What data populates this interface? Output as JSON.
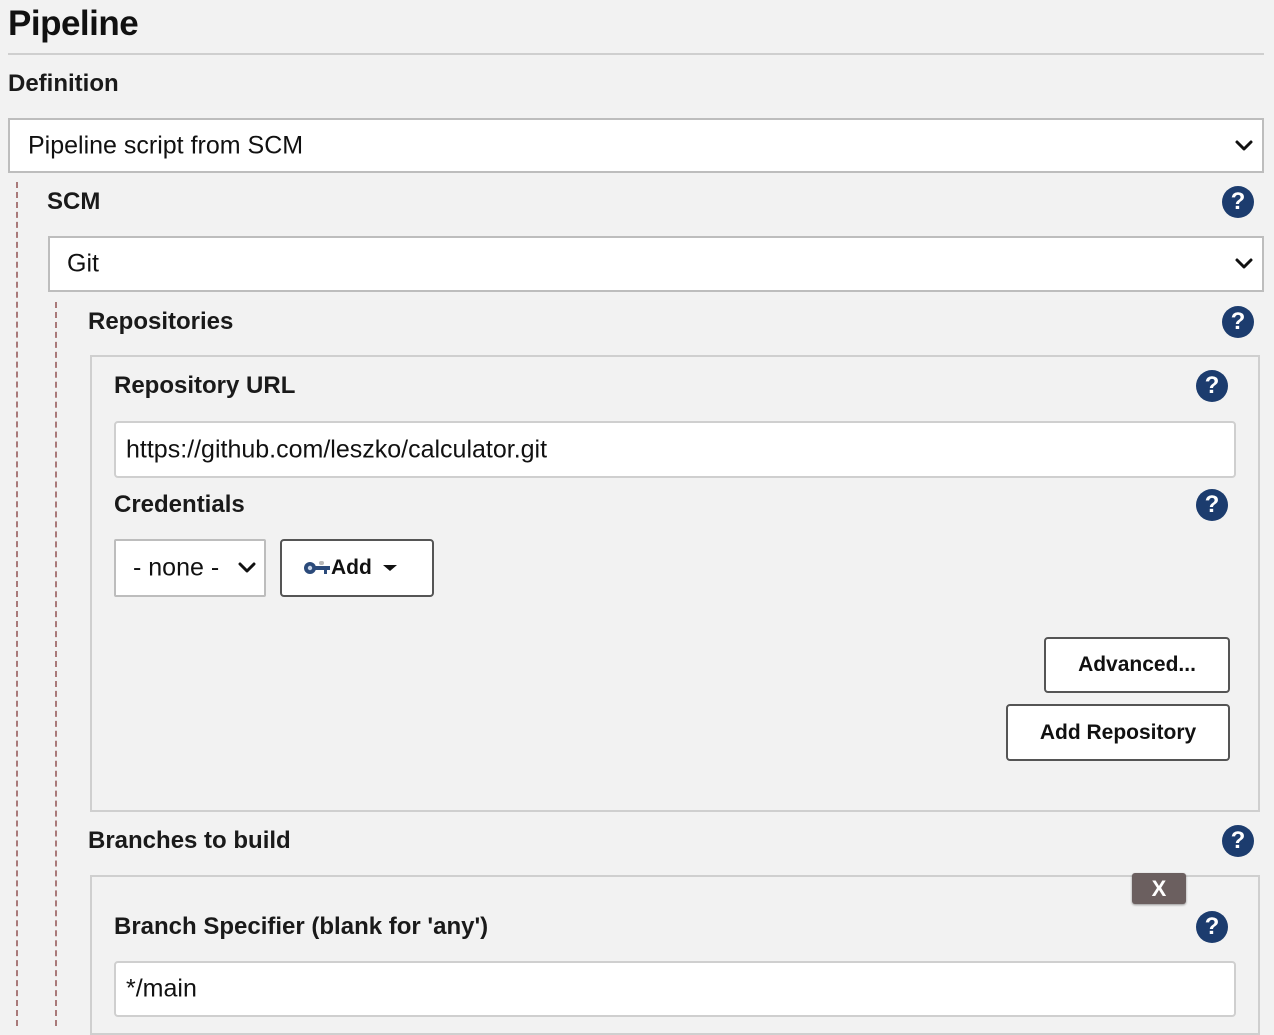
{
  "page": {
    "title": "Pipeline"
  },
  "definition": {
    "label": "Definition",
    "selected": "Pipeline script from SCM"
  },
  "scm": {
    "label": "SCM",
    "selected": "Git"
  },
  "repositories": {
    "label": "Repositories",
    "url_label": "Repository URL",
    "url_value": "https://github.com/leszko/calculator.git",
    "credentials_label": "Credentials",
    "credentials_selected": "- none -",
    "add_label": "Add",
    "advanced_label": "Advanced...",
    "add_repository_label": "Add Repository"
  },
  "branches": {
    "label": "Branches to build",
    "delete_label": "X",
    "specifier_label": "Branch Specifier (blank for 'any')",
    "specifier_value": "*/main"
  },
  "help": {
    "glyph": "?"
  },
  "colors": {
    "help_icon": "#1c3c6e",
    "page_background": "#f2f2f2",
    "delete_button": "#6b5f5f"
  }
}
